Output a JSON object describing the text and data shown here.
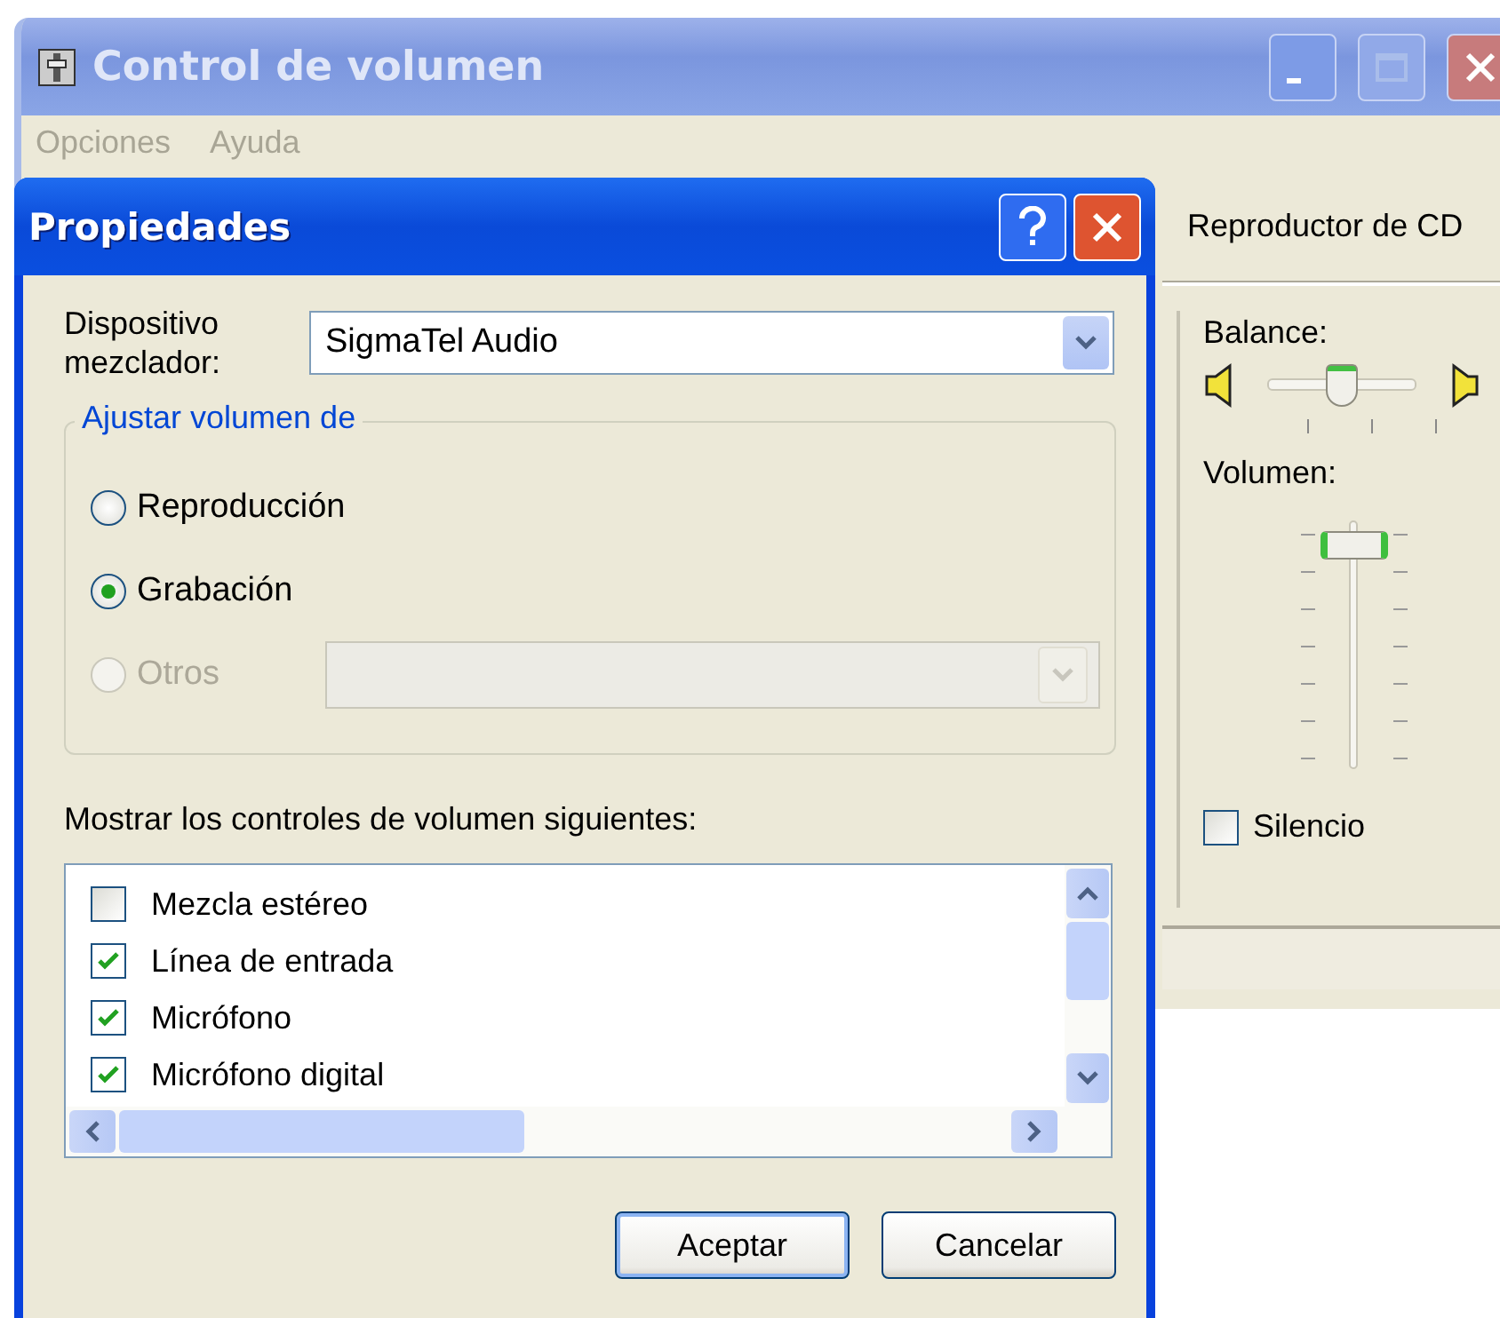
{
  "back_window": {
    "title": "Control de volumen",
    "menu": [
      "Opciones",
      "Ayuda"
    ]
  },
  "mixer_column": {
    "title": "Reproductor de CD",
    "balance": {
      "label": "Balance:",
      "level": 0.5
    },
    "volume": {
      "label": "Volumen:",
      "level": 0.95
    },
    "mute": {
      "label": "Silencio",
      "checked": false
    }
  },
  "dialog": {
    "title": "Propiedades",
    "device": {
      "label": "Dispositivo mezclador:",
      "value": "SigmaTel Audio"
    },
    "group": {
      "title": "Ajustar volumen de",
      "options": [
        {
          "label": "Reproducción",
          "selected": false,
          "disabled": false,
          "kind": "plain"
        },
        {
          "label": "Grabación",
          "selected": true,
          "disabled": false,
          "kind": "plain"
        },
        {
          "label": "Otros",
          "selected": false,
          "disabled": true,
          "kind": "with_dropdown"
        }
      ]
    },
    "list_label": "Mostrar los controles de volumen siguientes:",
    "controls": [
      {
        "label": "Mezcla estéreo",
        "checked": false
      },
      {
        "label": "Línea de entrada",
        "checked": true
      },
      {
        "label": "Micrófono",
        "checked": true
      },
      {
        "label": "Micrófono digital",
        "checked": true
      }
    ],
    "buttons": [
      {
        "label": "Aceptar",
        "default": true
      },
      {
        "label": "Cancelar",
        "default": false
      }
    ]
  }
}
